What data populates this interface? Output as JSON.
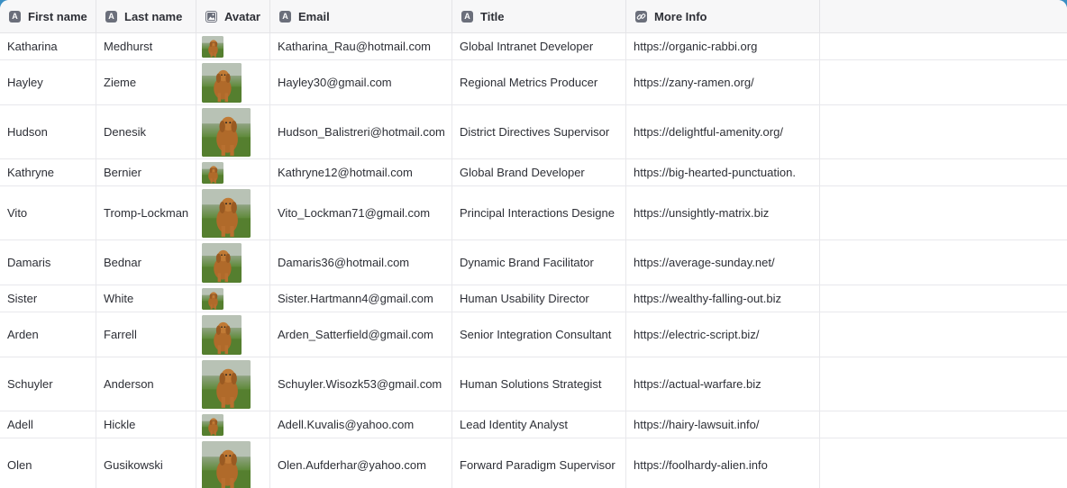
{
  "columns": [
    {
      "label": "First name",
      "icon": "text-icon"
    },
    {
      "label": "Last name",
      "icon": "text-icon"
    },
    {
      "label": "Avatar",
      "icon": "image-icon"
    },
    {
      "label": "Email",
      "icon": "text-icon"
    },
    {
      "label": "Title",
      "icon": "text-icon"
    },
    {
      "label": "More Info",
      "icon": "link-icon"
    }
  ],
  "rows": [
    {
      "first": "Katharina",
      "last": "Medhurst",
      "email": "Katharina_Rau@hotmail.com",
      "title": "Global Intranet Developer",
      "info": "https://organic-rabbi.org",
      "avatar_size": "small"
    },
    {
      "first": "Hayley",
      "last": "Zieme",
      "email": "Hayley30@gmail.com",
      "title": "Regional Metrics Producer",
      "info": "https://zany-ramen.org/",
      "avatar_size": "medium"
    },
    {
      "first": "Hudson",
      "last": "Denesik",
      "email": "Hudson_Balistreri@hotmail.com",
      "title": "District Directives Supervisor",
      "info": "https://delightful-amenity.org/",
      "avatar_size": "large"
    },
    {
      "first": "Kathryne",
      "last": "Bernier",
      "email": "Kathryne12@hotmail.com",
      "title": "Global Brand Developer",
      "info": "https://big-hearted-punctuation.",
      "avatar_size": "small"
    },
    {
      "first": "Vito",
      "last": "Tromp-Lockman",
      "email": "Vito_Lockman71@gmail.com",
      "title": "Principal Interactions Designe",
      "info": "https://unsightly-matrix.biz",
      "avatar_size": "large"
    },
    {
      "first": "Damaris",
      "last": "Bednar",
      "email": "Damaris36@hotmail.com",
      "title": "Dynamic Brand Facilitator",
      "info": "https://average-sunday.net/",
      "avatar_size": "medium"
    },
    {
      "first": "Sister",
      "last": "White",
      "email": "Sister.Hartmann4@gmail.com",
      "title": "Human Usability Director",
      "info": "https://wealthy-falling-out.biz",
      "avatar_size": "small"
    },
    {
      "first": "Arden",
      "last": "Farrell",
      "email": "Arden_Satterfield@gmail.com",
      "title": "Senior Integration Consultant",
      "info": "https://electric-script.biz/",
      "avatar_size": "medium"
    },
    {
      "first": "Schuyler",
      "last": "Anderson",
      "email": "Schuyler.Wisozk53@gmail.com",
      "title": "Human Solutions Strategist",
      "info": "https://actual-warfare.biz",
      "avatar_size": "large"
    },
    {
      "first": "Adell",
      "last": "Hickle",
      "email": "Adell.Kuvalis@yahoo.com",
      "title": "Lead Identity Analyst",
      "info": "https://hairy-lawsuit.info/",
      "avatar_size": "small"
    },
    {
      "first": "Olen",
      "last": "Gusikowski",
      "email": "Olen.Aufderhar@yahoo.com",
      "title": "Forward Paradigm Supervisor",
      "info": "https://foolhardy-alien.info",
      "avatar_size": "large"
    }
  ]
}
